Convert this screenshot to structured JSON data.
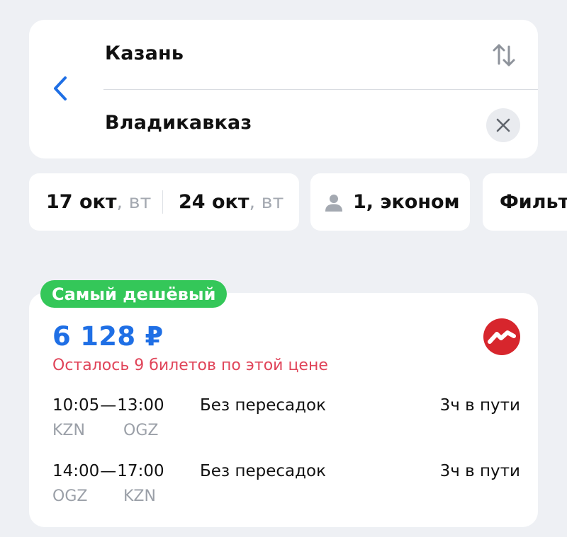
{
  "route": {
    "from": "Казань",
    "to": "Владикавказ"
  },
  "icons": {
    "back": "chevron-left-icon",
    "swap": "swap-vertical-icon",
    "clear": "close-icon",
    "passenger": "person-icon",
    "airline": "airline-logo"
  },
  "chips": {
    "date_out": {
      "day": "17 окт",
      "weekday": ", вт"
    },
    "date_back": {
      "day": "24 окт",
      "weekday": ", вт"
    },
    "passengers": "1, эконом",
    "filters": "Фильт"
  },
  "offer": {
    "badge": "Самый дешёвый",
    "price": "6 128 ₽",
    "seats_left": "Осталось 9 билетов по этой цене",
    "segments": [
      {
        "depart_time": "10:05",
        "arrive_time": "13:00",
        "from_code": "KZN",
        "to_code": "OGZ",
        "stops": "Без пересадок",
        "duration": "3ч в пути"
      },
      {
        "depart_time": "14:00",
        "arrive_time": "17:00",
        "from_code": "OGZ",
        "to_code": "KZN",
        "stops": "Без пересадок",
        "duration": "3ч в пути"
      }
    ]
  },
  "colors": {
    "accent": "#1f6fe5",
    "badge": "#34c759",
    "warning": "#e0455a",
    "airline_logo": "#d7262d",
    "background": "#eef0f4"
  }
}
